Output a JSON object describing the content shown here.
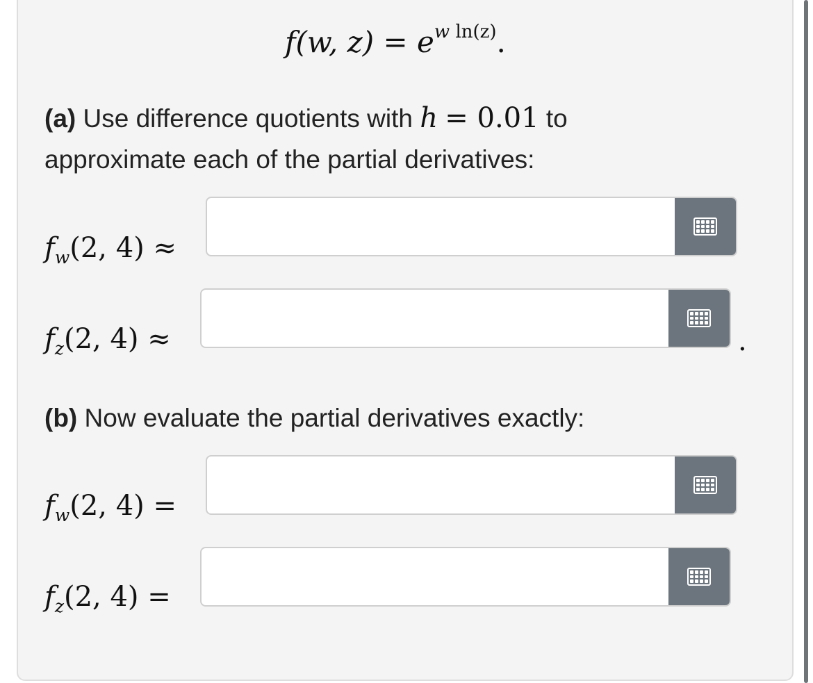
{
  "formula": {
    "lhs_f": "f",
    "lhs_args": "(w, z)",
    "eq": "=",
    "base": "e",
    "exp_var": "w",
    "exp_fn": "ln(z)",
    "end": "."
  },
  "part_a": {
    "tag": "(a)",
    "text_before": "Use difference quotients with",
    "h_var": "h",
    "h_eq": "= 0.01",
    "text_after": "to",
    "line2": "approximate each of the partial derivatives:"
  },
  "part_b": {
    "tag": "(b)",
    "text": "Now evaluate the partial derivatives exactly:"
  },
  "rows": {
    "a_fw": {
      "f": "f",
      "sub": "w",
      "args": "(2, 4)",
      "rel": "≈",
      "value": ""
    },
    "a_fz": {
      "f": "f",
      "sub": "z",
      "args": "(2, 4)",
      "rel": "≈",
      "value": ""
    },
    "b_fw": {
      "f": "f",
      "sub": "w",
      "args": "(2, 4)",
      "rel": "=",
      "value": ""
    },
    "b_fz": {
      "f": "f",
      "sub": "z",
      "args": "(2, 4)",
      "rel": "=",
      "value": ""
    }
  },
  "trailing_period": ".",
  "icons": {
    "keyboard": "keyboard-icon"
  },
  "colors": {
    "panel_bg": "#f4f4f4",
    "keyboard_button": "#6c757d",
    "input_border": "#cfcfcf"
  }
}
